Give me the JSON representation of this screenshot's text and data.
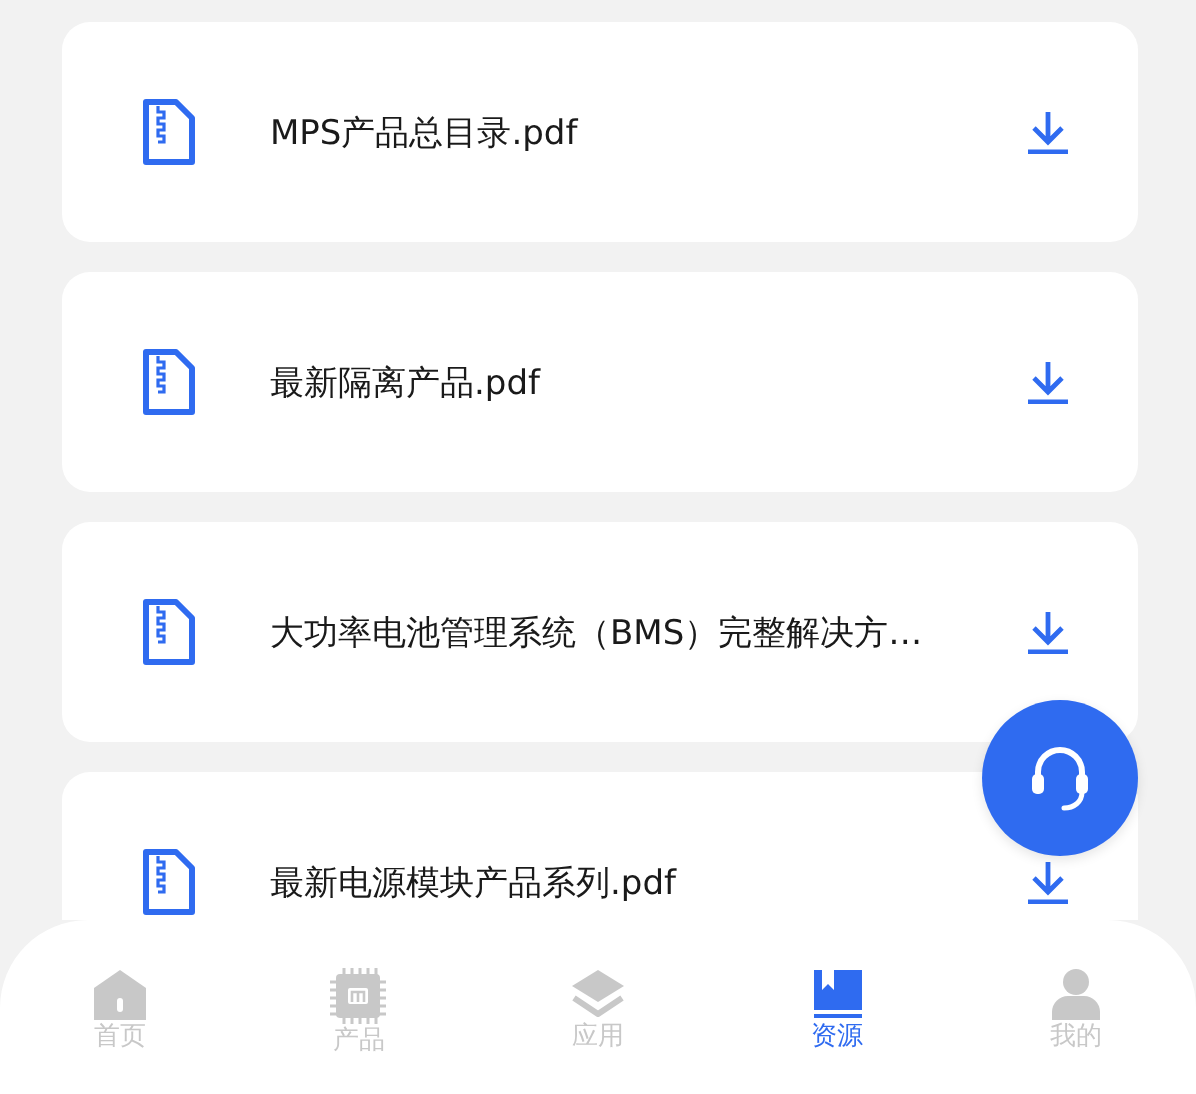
{
  "files": [
    {
      "name": "MPS产品总目录.pdf"
    },
    {
      "name": "最新隔离产品.pdf"
    },
    {
      "name": "大功率电池管理系统（BMS）完整解决方…"
    },
    {
      "name": "最新电源模块产品系列.pdf"
    }
  ],
  "nav": [
    {
      "kind": "home",
      "label": "首页",
      "selected": false
    },
    {
      "kind": "chip",
      "label": "产品",
      "selected": false
    },
    {
      "kind": "layers",
      "label": "应用",
      "selected": false
    },
    {
      "kind": "book",
      "label": "资源",
      "selected": true
    },
    {
      "kind": "user",
      "label": "我的",
      "selected": false
    }
  ]
}
